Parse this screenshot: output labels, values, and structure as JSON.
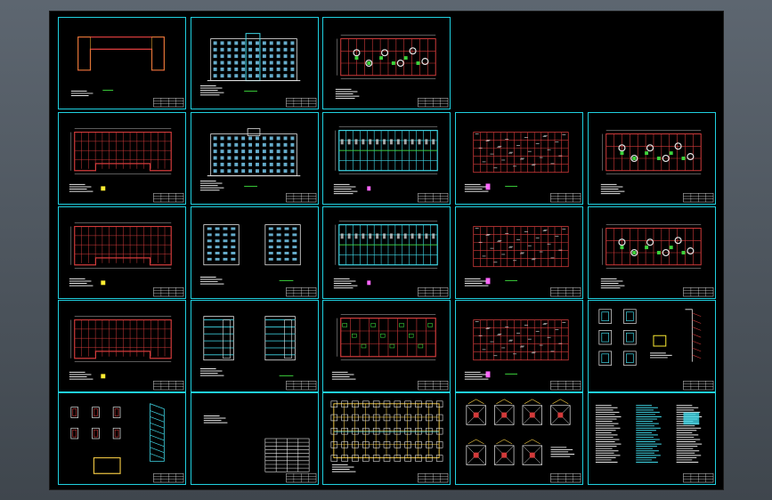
{
  "viewport": {
    "background": "#000000",
    "frame_color": "#1fd0e0"
  },
  "sheets": [
    {
      "kind": "site-outline",
      "accent": "#d23b3b"
    },
    {
      "kind": "front-elevation",
      "accent": "#e8e8e8"
    },
    {
      "kind": "roof-plan",
      "accent": "#d23b3b"
    },
    {
      "kind": "floor-plan",
      "accent": "#d23b3b"
    },
    {
      "kind": "rear-elevation",
      "accent": "#e8e8e8"
    },
    {
      "kind": "floor-plan-cyan",
      "accent": "#40d8e8"
    },
    {
      "kind": "rebar-plan",
      "accent": "#d23b3b"
    },
    {
      "kind": "roof-plan",
      "accent": "#d23b3b"
    },
    {
      "kind": "floor-plan",
      "accent": "#d23b3b"
    },
    {
      "kind": "side-elevations",
      "accent": "#e8e8e8"
    },
    {
      "kind": "floor-plan-cyan",
      "accent": "#40d8e8"
    },
    {
      "kind": "rebar-plan",
      "accent": "#d23b3b"
    },
    {
      "kind": "roof-plan",
      "accent": "#d23b3b"
    },
    {
      "kind": "floor-plan",
      "accent": "#d23b3b"
    },
    {
      "kind": "section-elevations",
      "accent": "#e8e8e8"
    },
    {
      "kind": "beam-plan",
      "accent": "#d23b3b"
    },
    {
      "kind": "rebar-plan",
      "accent": "#d23b3b"
    },
    {
      "kind": "details",
      "accent": "#40d8e8"
    },
    {
      "kind": "stair-details",
      "accent": "#d23b3b"
    },
    {
      "kind": "notes-table",
      "accent": "#e8e8e8"
    },
    {
      "kind": "foundation-plan",
      "accent": "#e8c040"
    },
    {
      "kind": "footing-details",
      "accent": "#e8e8e8"
    },
    {
      "kind": "general-notes",
      "accent": "#40d8e8"
    }
  ]
}
